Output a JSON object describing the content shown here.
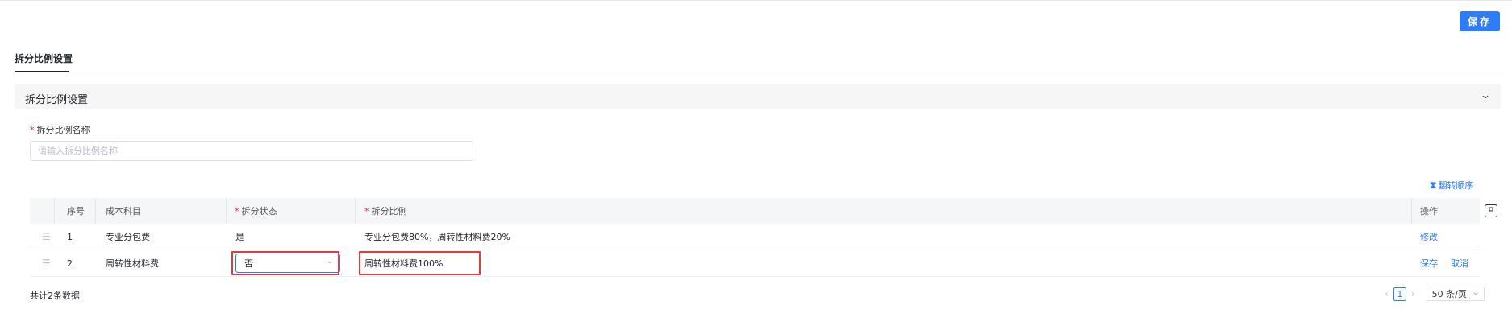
{
  "toolbar": {
    "save_label": "保存"
  },
  "tabs": [
    {
      "label": "拆分比例设置",
      "active": true
    }
  ],
  "section": {
    "title": "拆分比例设置",
    "collapse_icon": "chevron-down-icon"
  },
  "form": {
    "name_label": "拆分比例名称",
    "name_required_mark": "*",
    "name_placeholder": "请输入拆分比例名称",
    "name_value": ""
  },
  "table_tools": {
    "flip_label": "翻转顺序",
    "flip_icon": "hourglass-icon",
    "settings_icon": "column-settings-icon"
  },
  "table": {
    "headers": {
      "index": "序号",
      "subject": "成本科目",
      "status": "拆分状态",
      "ratio": "拆分比例",
      "action": "操作"
    },
    "required_mark": "*",
    "rows": [
      {
        "index": "1",
        "subject": "专业分包费",
        "status": "是",
        "ratio": "专业分包费80%，周转性材料费20%",
        "actions": [
          "修改"
        ]
      },
      {
        "index": "2",
        "subject": "周转性材料费",
        "status": "否",
        "ratio": "周转性材料费100%",
        "actions": [
          "保存",
          "取消"
        ],
        "editing": true
      }
    ]
  },
  "footer": {
    "total_text": "共计2条数据",
    "current_page": "1",
    "page_size": "50 条/页"
  },
  "colors": {
    "primary": "#2f7cf6",
    "highlight": "#e23c3c",
    "required": "#f5222d"
  }
}
